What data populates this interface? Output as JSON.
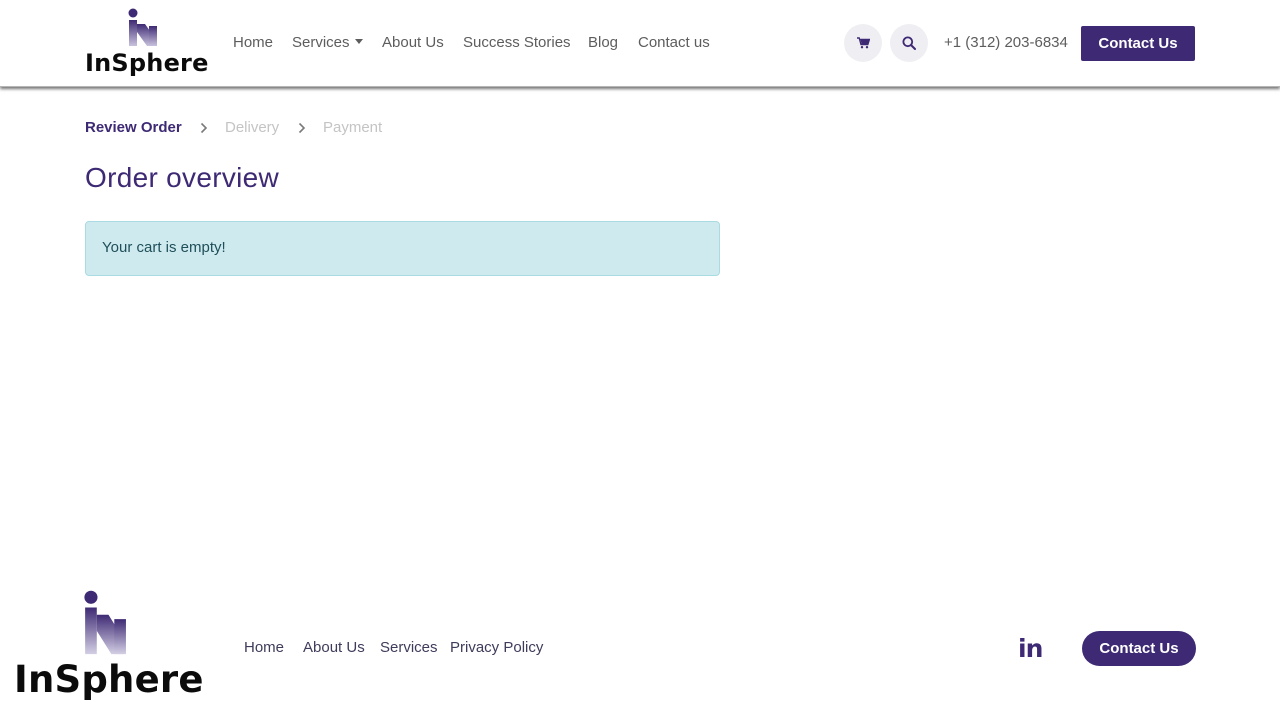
{
  "brand": {
    "logo_text": "InSphere",
    "accent": "#3e2a74",
    "alert_bg": "#cfeaef"
  },
  "header": {
    "nav": [
      {
        "label": "Home"
      },
      {
        "label": "Services",
        "has_dropdown": true
      },
      {
        "label": "About Us"
      },
      {
        "label": "Success Stories"
      },
      {
        "label": "Blog"
      },
      {
        "label": "Contact us"
      }
    ],
    "cart_icon": "shopping-cart-icon",
    "search_icon": "search-icon",
    "phone": "+1 (312) 203-6834",
    "cta_label": "Contact Us"
  },
  "checkout": {
    "steps": [
      {
        "label": "Review Order",
        "active": true
      },
      {
        "label": "Delivery",
        "active": false
      },
      {
        "label": "Payment",
        "active": false
      }
    ],
    "title": "Order overview",
    "empty_message": "Your cart is empty!"
  },
  "footer": {
    "links": [
      {
        "label": "Home"
      },
      {
        "label": "About Us"
      },
      {
        "label": "Services"
      },
      {
        "label": "Privacy Policy"
      }
    ],
    "social_icon": "linkedin-icon",
    "social_label": "in",
    "cta_label": "Contact Us"
  }
}
